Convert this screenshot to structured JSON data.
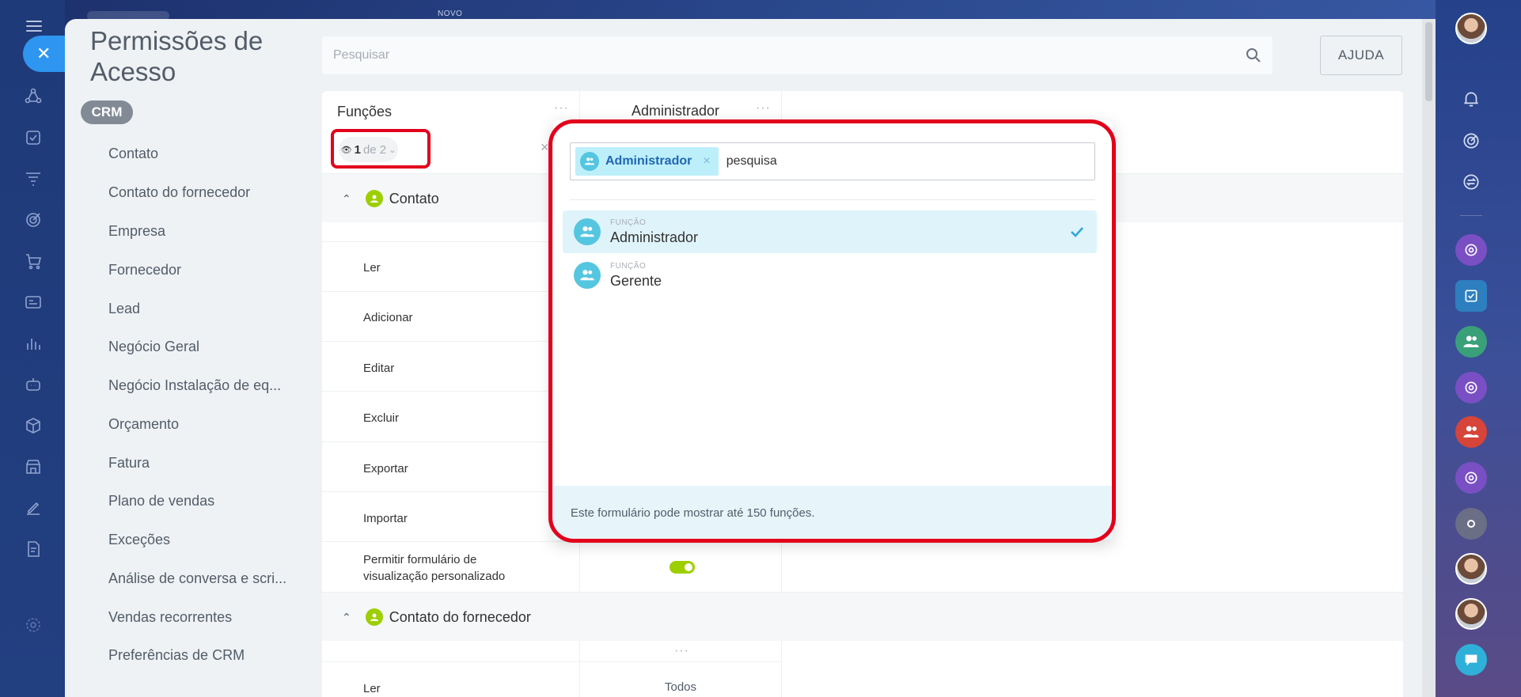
{
  "top": {
    "novo_label": "NOVO"
  },
  "page": {
    "title": "Permissões de Acesso"
  },
  "search": {
    "placeholder": "Pesquisar"
  },
  "help": {
    "label": "AJUDA"
  },
  "nav": {
    "badge": "CRM",
    "items": [
      "Contato",
      "Contato do fornecedor",
      "Empresa",
      "Fornecedor",
      "Lead",
      "Negócio Geral",
      "Negócio Instalação de eq...",
      "Orçamento",
      "Fatura",
      "Plano de vendas",
      "Exceções",
      "Análise de conversa e scri...",
      "Vendas recorrentes",
      "Preferências de CRM"
    ]
  },
  "table": {
    "roles_header": "Funções",
    "column_header": "Administrador",
    "dots": "···",
    "filter": {
      "count": "1",
      "of_total": "de 2"
    },
    "section1": "Contato",
    "section2": "Contato do fornecedor",
    "permissions": [
      "Ler",
      "Adicionar",
      "Editar",
      "Excluir",
      "Exportar",
      "Importar"
    ],
    "custom_view_perm": "Permitir formulário de visualização personalizado",
    "section2_perm": "Ler",
    "section2_value": "Todos",
    "toggle_on": true
  },
  "popup": {
    "selected_chip": "Administrador",
    "input_value": "pesquisa",
    "items": [
      {
        "kind": "FUNÇÃO",
        "name": "Administrador",
        "selected": true
      },
      {
        "kind": "FUNÇÃO",
        "name": "Gerente",
        "selected": false
      }
    ],
    "footer": "Este formulário pode mostrar até 150 funções."
  },
  "colors": {
    "accent_blue": "#2e95f0",
    "highlight_red": "#e3001b",
    "green": "#9dcf00",
    "chip_bg": "#bdeffb",
    "role_avatar": "#55c6e0"
  },
  "icons": {
    "rail": [
      "menu-icon",
      "close-icon",
      "activity-icon",
      "tasks-icon",
      "funnel-icon",
      "target-icon",
      "cart-icon",
      "card-icon",
      "chart-icon",
      "robot-icon",
      "box-icon",
      "store-icon",
      "pen-icon",
      "doc-icon",
      "settings-icon"
    ],
    "right_rail": [
      "avatar",
      "bell-icon",
      "radar-icon",
      "sync-icon",
      "openline-icon",
      "task-icon",
      "group-icon",
      "openline-icon",
      "group-icon",
      "openline-icon",
      "circle-icon",
      "avatar",
      "avatar",
      "chat-icon"
    ]
  }
}
